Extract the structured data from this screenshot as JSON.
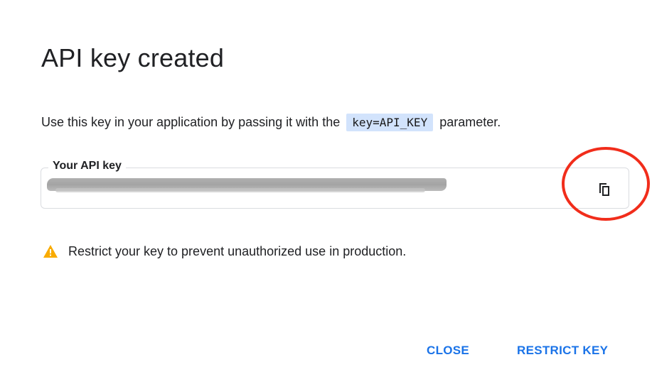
{
  "dialog": {
    "title": "API key created",
    "description_before": "Use this key in your application by passing it with the",
    "code_param": "key=API_KEY",
    "description_after": "parameter."
  },
  "key_field": {
    "label": "Your API key",
    "copy_icon": "copy-icon"
  },
  "warning": {
    "icon": "warning-icon",
    "text": "Restrict your key to prevent unauthorized use in production."
  },
  "actions": {
    "close_label": "CLOSE",
    "restrict_label": "RESTRICT KEY"
  },
  "colors": {
    "accent": "#1a73e8",
    "code_highlight": "#d2e3fc",
    "warning": "#f9ab00",
    "annotation_ring": "#f12d1b"
  }
}
